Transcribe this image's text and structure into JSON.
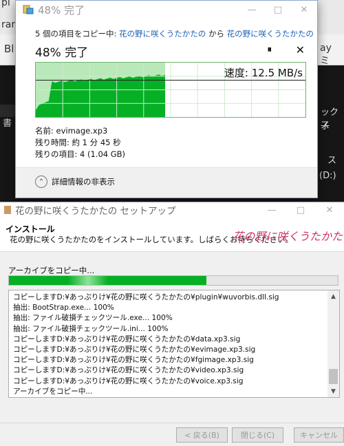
{
  "background": {
    "frag_tl": "pi",
    "frag_ml": "rar",
    "frag_bl": "Bl",
    "frag_br": "ay ミ",
    "frag_sidebar": "書",
    "frag_right1": "ックス",
    "frag_right2": "子",
    "frag_right3": "ス",
    "frag_right4": "(D:)"
  },
  "copy_dialog": {
    "title": "48% 完了",
    "from_prefix": "5 個の項目をコピー中: ",
    "from_source": "花の野に咲くうたかたの",
    "from_mid": " から ",
    "from_dest": "花の野に咲くうたかたの",
    "percent_label": "48% 完了",
    "pause_icon": "⏸",
    "close_icon": "✕",
    "speed": "速度: 12.5 MB/s",
    "progress": 0.48,
    "name_line": "名前: evimage.xp3",
    "time_line": "残り時間: 約 1 分 45 秒",
    "items_line": "残りの項目: 4 (1.04 GB)",
    "toggle_label": "詳細情報の非表示",
    "colors": {
      "graph_fill": "#06b025",
      "graph_bg": "#b9e8b9",
      "link": "#1a5fb4"
    }
  },
  "setup_dialog": {
    "title": "花の野に咲くうたかたの セットアップ",
    "section_title": "インストール",
    "description": "花の野に咲くうたかたのをインストールしています。しばらくお待ちください。",
    "logo_text": "花の野に咲くうたかた",
    "copying_label": "アーカイブをコピー中...",
    "progress": 0.6,
    "log_lines": [
      "コピーしますD:¥あっぷりけ¥花の野に咲くうたかたの¥plugin¥wuvorbis.dll.sig",
      "抽出: BootStrap.exe... 100%",
      "抽出: ファイル破損チェックツール.exe... 100%",
      "抽出: ファイル破損チェックツール.ini... 100%",
      "コピーしますD:¥あっぷりけ¥花の野に咲くうたかたの¥data.xp3.sig",
      "コピーしますD:¥あっぷりけ¥花の野に咲くうたかたの¥evimage.xp3.sig",
      "コピーしますD:¥あっぷりけ¥花の野に咲くうたかたの¥fgimage.xp3.sig",
      "コピーしますD:¥あっぷりけ¥花の野に咲くうたかたの¥video.xp3.sig",
      "コピーしますD:¥あっぷりけ¥花の野に咲くうたかたの¥voice.xp3.sig",
      "アーカイブをコピー中..."
    ],
    "back_button": "< 戻る(B)",
    "close_button": "閉じる(C)",
    "cancel_button": "キャンセル",
    "colors": {
      "progress": "#06b025",
      "logo": "#cc3366"
    }
  }
}
